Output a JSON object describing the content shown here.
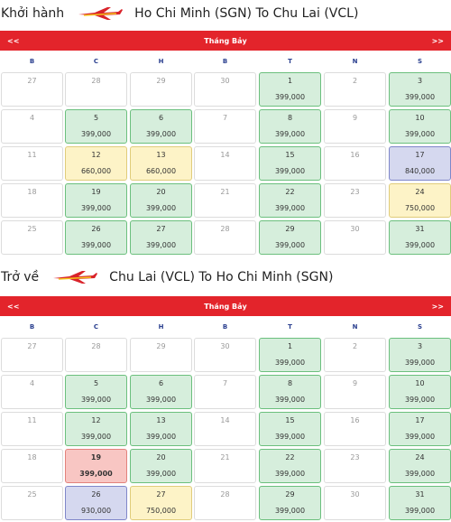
{
  "outbound": {
    "direction": "Khởi hành",
    "route": "Ho Chi Minh (SGN) To Chu Lai (VCL)",
    "month": "Tháng Bảy",
    "prev": "<<",
    "next": ">>",
    "weekdays": [
      "B",
      "C",
      "H",
      "B",
      "T",
      "N",
      "S"
    ],
    "weeks": [
      [
        {
          "day": "27",
          "price": ""
        },
        {
          "day": "28",
          "price": ""
        },
        {
          "day": "29",
          "price": ""
        },
        {
          "day": "30",
          "price": ""
        },
        {
          "day": "1",
          "price": "399,000",
          "color": "green"
        },
        {
          "day": "2",
          "price": ""
        },
        {
          "day": "3",
          "price": "399,000",
          "color": "green"
        }
      ],
      [
        {
          "day": "4",
          "price": ""
        },
        {
          "day": "5",
          "price": "399,000",
          "color": "green"
        },
        {
          "day": "6",
          "price": "399,000",
          "color": "green"
        },
        {
          "day": "7",
          "price": ""
        },
        {
          "day": "8",
          "price": "399,000",
          "color": "green"
        },
        {
          "day": "9",
          "price": ""
        },
        {
          "day": "10",
          "price": "399,000",
          "color": "green"
        }
      ],
      [
        {
          "day": "11",
          "price": ""
        },
        {
          "day": "12",
          "price": "660,000",
          "color": "yellow"
        },
        {
          "day": "13",
          "price": "660,000",
          "color": "yellow"
        },
        {
          "day": "14",
          "price": ""
        },
        {
          "day": "15",
          "price": "399,000",
          "color": "green"
        },
        {
          "day": "16",
          "price": ""
        },
        {
          "day": "17",
          "price": "840,000",
          "color": "purple"
        }
      ],
      [
        {
          "day": "18",
          "price": ""
        },
        {
          "day": "19",
          "price": "399,000",
          "color": "green"
        },
        {
          "day": "20",
          "price": "399,000",
          "color": "green"
        },
        {
          "day": "21",
          "price": ""
        },
        {
          "day": "22",
          "price": "399,000",
          "color": "green"
        },
        {
          "day": "23",
          "price": ""
        },
        {
          "day": "24",
          "price": "750,000",
          "color": "yellow"
        }
      ],
      [
        {
          "day": "25",
          "price": ""
        },
        {
          "day": "26",
          "price": "399,000",
          "color": "green"
        },
        {
          "day": "27",
          "price": "399,000",
          "color": "green"
        },
        {
          "day": "28",
          "price": ""
        },
        {
          "day": "29",
          "price": "399,000",
          "color": "green"
        },
        {
          "day": "30",
          "price": ""
        },
        {
          "day": "31",
          "price": "399,000",
          "color": "green"
        }
      ]
    ]
  },
  "return": {
    "direction": "Trở về",
    "route": "Chu Lai (VCL) To Ho Chi Minh (SGN)",
    "month": "Tháng Bảy",
    "prev": "<<",
    "next": ">>",
    "weekdays": [
      "B",
      "C",
      "H",
      "B",
      "T",
      "N",
      "S"
    ],
    "weeks": [
      [
        {
          "day": "27",
          "price": ""
        },
        {
          "day": "28",
          "price": ""
        },
        {
          "day": "29",
          "price": ""
        },
        {
          "day": "30",
          "price": ""
        },
        {
          "day": "1",
          "price": "399,000",
          "color": "green"
        },
        {
          "day": "2",
          "price": ""
        },
        {
          "day": "3",
          "price": "399,000",
          "color": "green"
        }
      ],
      [
        {
          "day": "4",
          "price": ""
        },
        {
          "day": "5",
          "price": "399,000",
          "color": "green"
        },
        {
          "day": "6",
          "price": "399,000",
          "color": "green"
        },
        {
          "day": "7",
          "price": ""
        },
        {
          "day": "8",
          "price": "399,000",
          "color": "green"
        },
        {
          "day": "9",
          "price": ""
        },
        {
          "day": "10",
          "price": "399,000",
          "color": "green"
        }
      ],
      [
        {
          "day": "11",
          "price": ""
        },
        {
          "day": "12",
          "price": "399,000",
          "color": "green"
        },
        {
          "day": "13",
          "price": "399,000",
          "color": "green"
        },
        {
          "day": "14",
          "price": ""
        },
        {
          "day": "15",
          "price": "399,000",
          "color": "green"
        },
        {
          "day": "16",
          "price": ""
        },
        {
          "day": "17",
          "price": "399,000",
          "color": "green"
        }
      ],
      [
        {
          "day": "18",
          "price": ""
        },
        {
          "day": "19",
          "price": "399,000",
          "color": "red"
        },
        {
          "day": "20",
          "price": "399,000",
          "color": "green"
        },
        {
          "day": "21",
          "price": ""
        },
        {
          "day": "22",
          "price": "399,000",
          "color": "green"
        },
        {
          "day": "23",
          "price": ""
        },
        {
          "day": "24",
          "price": "399,000",
          "color": "green"
        }
      ],
      [
        {
          "day": "25",
          "price": ""
        },
        {
          "day": "26",
          "price": "930,000",
          "color": "purple"
        },
        {
          "day": "27",
          "price": "750,000",
          "color": "yellow"
        },
        {
          "day": "28",
          "price": ""
        },
        {
          "day": "29",
          "price": "399,000",
          "color": "green"
        },
        {
          "day": "30",
          "price": ""
        },
        {
          "day": "31",
          "price": "399,000",
          "color": "green"
        }
      ]
    ]
  },
  "colors": {
    "bar": "#e3242b",
    "weekday": "#2a3f8f",
    "green": "#d6eedc",
    "yellow": "#fdf3c7",
    "purple": "#d5d8ef",
    "red": "#f8c6c3"
  },
  "icons": {
    "airline_logo": "plane-logo-icon"
  }
}
